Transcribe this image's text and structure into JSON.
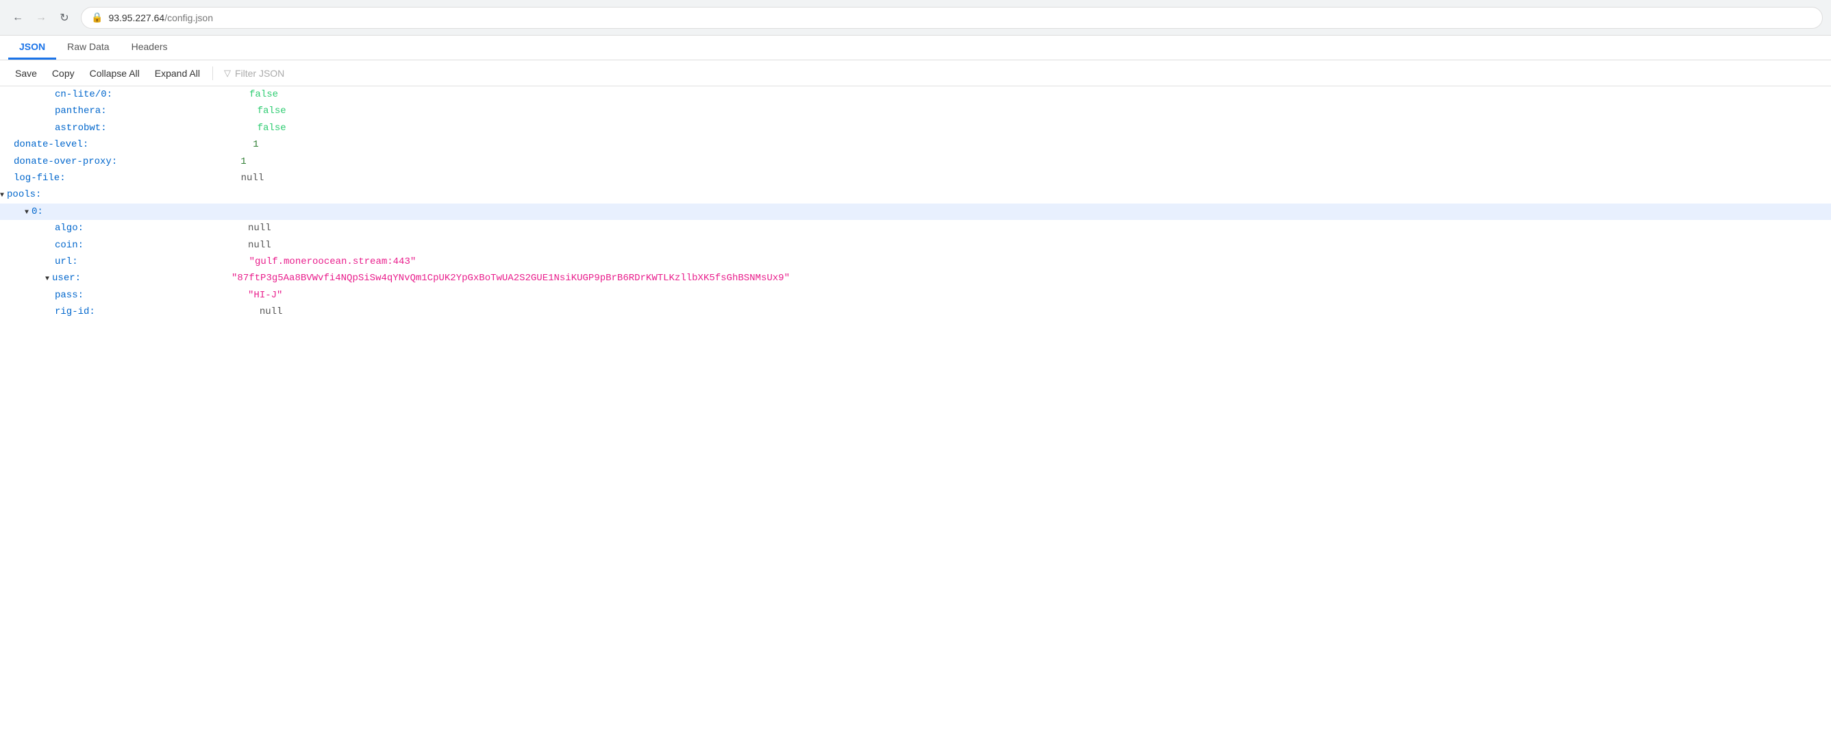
{
  "browser": {
    "back_button": "←",
    "forward_button": "→",
    "refresh_button": "↻",
    "url_host": "93.95.227.64",
    "url_path": "/config.json",
    "lock_icon": "🔒"
  },
  "tabs": [
    {
      "label": "JSON",
      "active": true
    },
    {
      "label": "Raw Data",
      "active": false
    },
    {
      "label": "Headers",
      "active": false
    }
  ],
  "toolbar": {
    "save_label": "Save",
    "copy_label": "Copy",
    "collapse_all_label": "Collapse All",
    "expand_all_label": "Expand All",
    "filter_placeholder": "Filter JSON"
  },
  "json_lines": [
    {
      "indent": 2,
      "key": "cn-lite/0:",
      "value": "false",
      "type": "false",
      "arrow": null
    },
    {
      "indent": 2,
      "key": "panthera:",
      "value": "false",
      "type": "false",
      "arrow": null
    },
    {
      "indent": 2,
      "key": "astrobwt:",
      "value": "false",
      "type": "false",
      "arrow": null
    },
    {
      "indent": 0,
      "key": "donate-level:",
      "value": "1",
      "type": "number",
      "arrow": null
    },
    {
      "indent": 0,
      "key": "donate-over-proxy:",
      "value": "1",
      "type": "number",
      "arrow": null
    },
    {
      "indent": 0,
      "key": "log-file:",
      "value": "null",
      "type": "null",
      "arrow": null
    },
    {
      "indent": 0,
      "key": "pools:",
      "value": "",
      "type": "section",
      "arrow": "▼"
    },
    {
      "indent": 1,
      "key": "0:",
      "value": "",
      "type": "section",
      "arrow": "▼",
      "highlighted": true
    },
    {
      "indent": 2,
      "key": "algo:",
      "value": "null",
      "type": "null",
      "arrow": null
    },
    {
      "indent": 2,
      "key": "coin:",
      "value": "null",
      "type": "null",
      "arrow": null
    },
    {
      "indent": 2,
      "key": "url:",
      "value": "\"gulf.moneroocean.stream:443\"",
      "type": "string",
      "arrow": null
    },
    {
      "indent": 2,
      "key": "user:",
      "value": "\"87ftP3g5Aa8BVWvfi4NQpSiSw4qYNvQm1CpUK2YpGxBoTwUA2S2GUE1NsiKUGP9pBrB6RDrKWTLKzllbXK5fsGhBSNMsUx9\"",
      "type": "string",
      "arrow": "▼"
    },
    {
      "indent": 2,
      "key": "pass:",
      "value": "\"HI-J\"",
      "type": "string",
      "arrow": null
    },
    {
      "indent": 2,
      "key": "rig-id:",
      "value": "null",
      "type": "null",
      "arrow": null
    }
  ]
}
